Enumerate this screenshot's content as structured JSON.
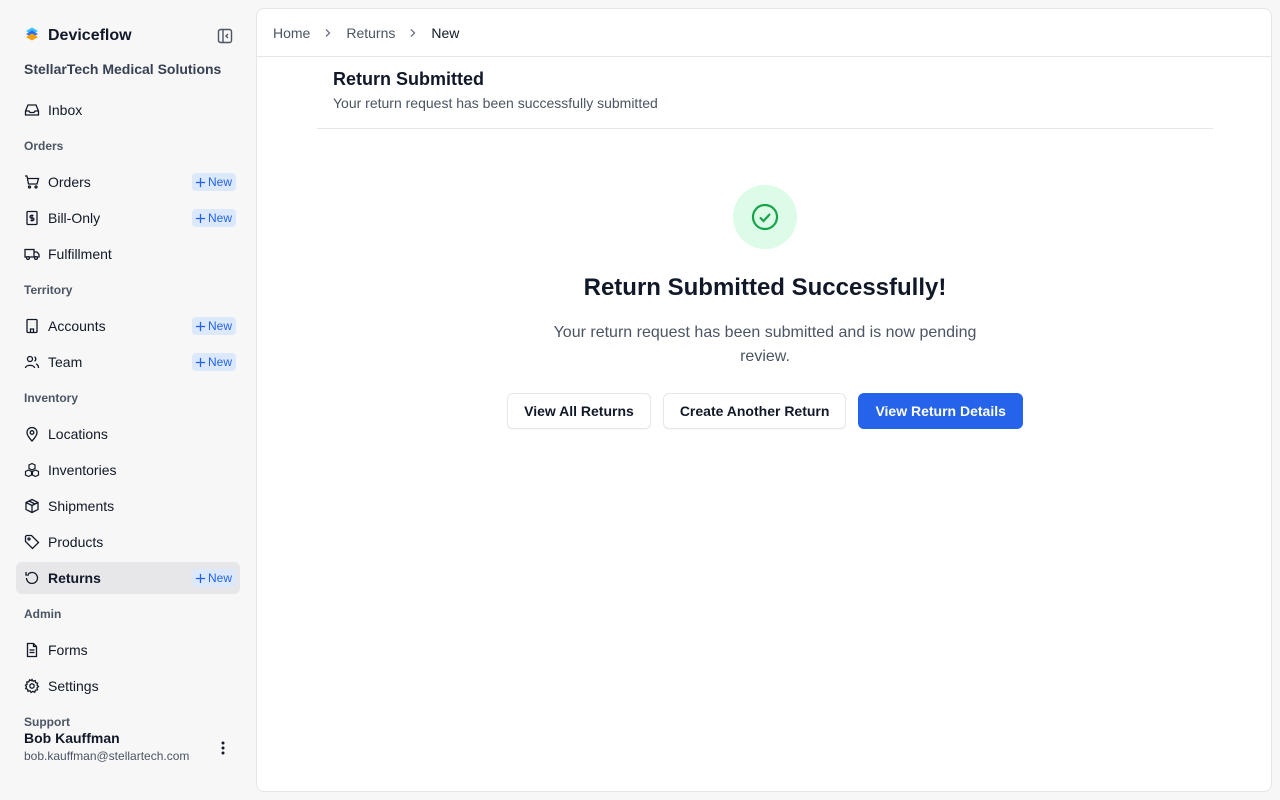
{
  "app": {
    "name": "Deviceflow",
    "org": "StellarTech Medical Solutions"
  },
  "colors": {
    "accent": "#2563eb",
    "success": "#16a34a",
    "success_bg": "#dcfce7"
  },
  "sidebar": {
    "new_label": "New",
    "inbox": "Inbox",
    "sections": {
      "orders": "Orders",
      "territory": "Territory",
      "inventory": "Inventory",
      "admin": "Admin",
      "support": "Support"
    },
    "items": {
      "orders": "Orders",
      "bill_only": "Bill-Only",
      "fulfillment": "Fulfillment",
      "accounts": "Accounts",
      "team": "Team",
      "locations": "Locations",
      "inventories": "Inventories",
      "shipments": "Shipments",
      "products": "Products",
      "returns": "Returns",
      "forms": "Forms",
      "settings": "Settings"
    }
  },
  "user": {
    "name": "Bob Kauffman",
    "email": "bob.kauffman@stellartech.com"
  },
  "breadcrumb": {
    "home": "Home",
    "returns": "Returns",
    "current": "New"
  },
  "page": {
    "title": "Return Submitted",
    "subtitle": "Your return request has been successfully submitted"
  },
  "success": {
    "title": "Return Submitted Successfully!",
    "message": "Your return request has been submitted and is now pending review."
  },
  "actions": {
    "view_all": "View All Returns",
    "create_another": "Create Another Return",
    "view_details": "View Return Details"
  }
}
